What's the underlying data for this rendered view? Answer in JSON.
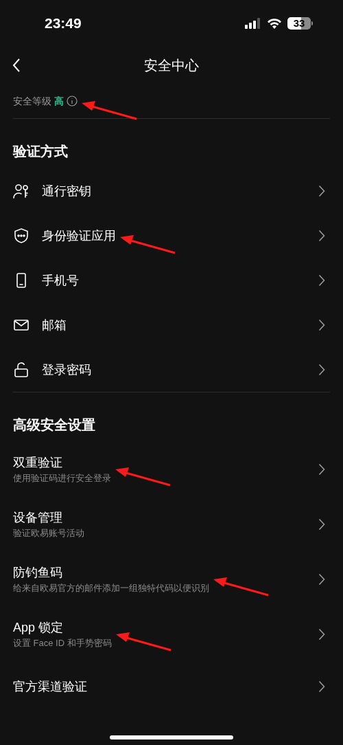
{
  "status_bar": {
    "time": "23:49",
    "battery": "33"
  },
  "nav": {
    "title": "安全中心"
  },
  "security_level": {
    "label": "安全等级",
    "value": "高",
    "annotated": true
  },
  "sections": [
    {
      "title": "验证方式",
      "items": [
        {
          "label": "通行密钥",
          "kind": "passkey",
          "annotated": false
        },
        {
          "label": "身份验证应用",
          "kind": "authenticator",
          "annotated": true
        },
        {
          "label": "手机号",
          "kind": "phone",
          "annotated": false
        },
        {
          "label": "邮箱",
          "kind": "email",
          "annotated": false
        },
        {
          "label": "登录密码",
          "kind": "password",
          "annotated": false
        }
      ]
    },
    {
      "title": "高级安全设置",
      "items": [
        {
          "label": "双重验证",
          "subtitle": "使用验证码进行安全登录",
          "annotated": true
        },
        {
          "label": "设备管理",
          "subtitle": "验证欧易账号活动",
          "annotated": false
        },
        {
          "label": "防钓鱼码",
          "subtitle": "给来自欧易官方的邮件添加一组独特代码以便识别",
          "annotated": true
        },
        {
          "label": "App 锁定",
          "subtitle": "设置 Face ID 和手势密码",
          "annotated": true
        },
        {
          "label": "官方渠道验证",
          "annotated": false
        }
      ]
    }
  ]
}
